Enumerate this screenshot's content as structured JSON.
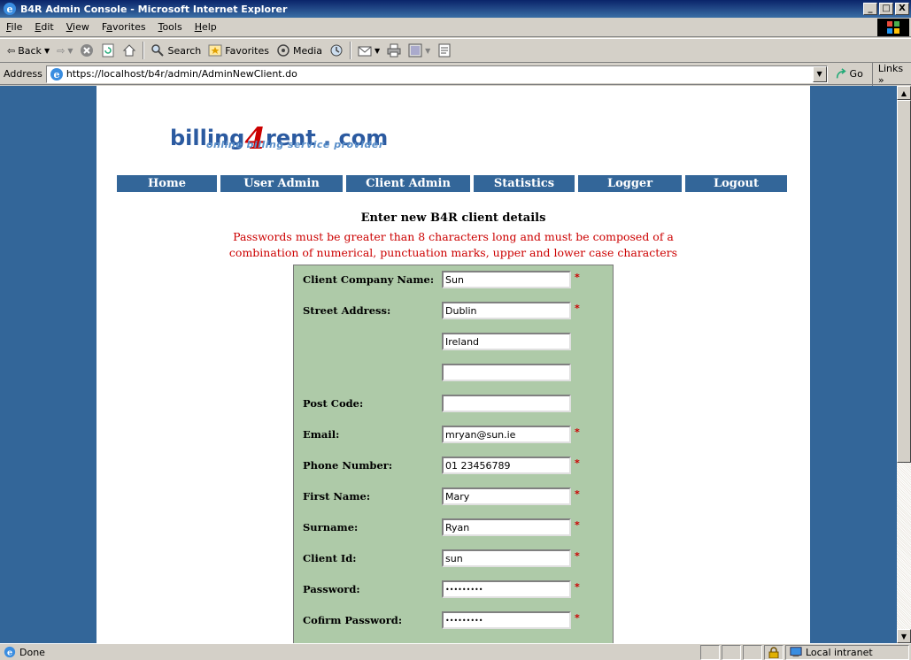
{
  "window": {
    "title": "B4R Admin Console - Microsoft Internet Explorer",
    "buttons": [
      "_",
      "□",
      "X"
    ]
  },
  "menu": {
    "items": [
      {
        "first": "F",
        "rest": "ile"
      },
      {
        "first": "E",
        "rest": "dit"
      },
      {
        "first": "V",
        "rest": "iew"
      },
      {
        "pre": "F",
        "first": "a",
        "rest": "vorites"
      },
      {
        "first": "T",
        "rest": "ools"
      },
      {
        "first": "H",
        "rest": "elp"
      }
    ]
  },
  "toolbar": {
    "back": "Back",
    "search": "Search",
    "favorites": "Favorites",
    "media": "Media"
  },
  "address": {
    "label": "Address",
    "url": "https://localhost/b4r/admin/AdminNewClient.do",
    "go": "Go",
    "links": "Links"
  },
  "logo": {
    "pre": "billing",
    "four": "4",
    "post": "rent . com",
    "tagline": "online billing service provider"
  },
  "nav": {
    "items": [
      "Home",
      "User Admin",
      "Client Admin",
      "Statistics",
      "Logger",
      "Logout"
    ]
  },
  "form": {
    "heading": "Enter new B4R client details",
    "warning_line1": "Passwords must be greater than 8 characters long and must be composed of a",
    "warning_line2": "combination of numerical, punctuation marks, upper and lower case characters",
    "required_mark": "*",
    "fields": [
      {
        "label": "Client Company Name:",
        "value": "Sun",
        "required": true
      },
      {
        "label": "Street Address:",
        "value": "Dublin",
        "required": true
      },
      {
        "label": "",
        "value": "Ireland",
        "required": false
      },
      {
        "label": "",
        "value": "",
        "required": false
      },
      {
        "label": "Post Code:",
        "value": "",
        "required": false
      },
      {
        "label": "Email:",
        "value": "mryan@sun.ie",
        "required": true
      },
      {
        "label": "Phone Number:",
        "value": "01 23456789",
        "required": true
      },
      {
        "label": "First Name:",
        "value": "Mary",
        "required": true
      },
      {
        "label": "Surname:",
        "value": "Ryan",
        "required": true
      },
      {
        "label": "Client Id:",
        "value": "sun",
        "required": true
      },
      {
        "label": "Password:",
        "value": "•••••••••",
        "required": true
      },
      {
        "label": "Cofirm Password:",
        "value": "•••••••••",
        "required": true
      }
    ]
  },
  "status": {
    "text": "Done",
    "zone": "Local intranet"
  },
  "colors": {
    "page_bg": "#336699",
    "nav_bg": "#336699",
    "form_bg": "#aecaa8",
    "warning": "#cc0000"
  }
}
